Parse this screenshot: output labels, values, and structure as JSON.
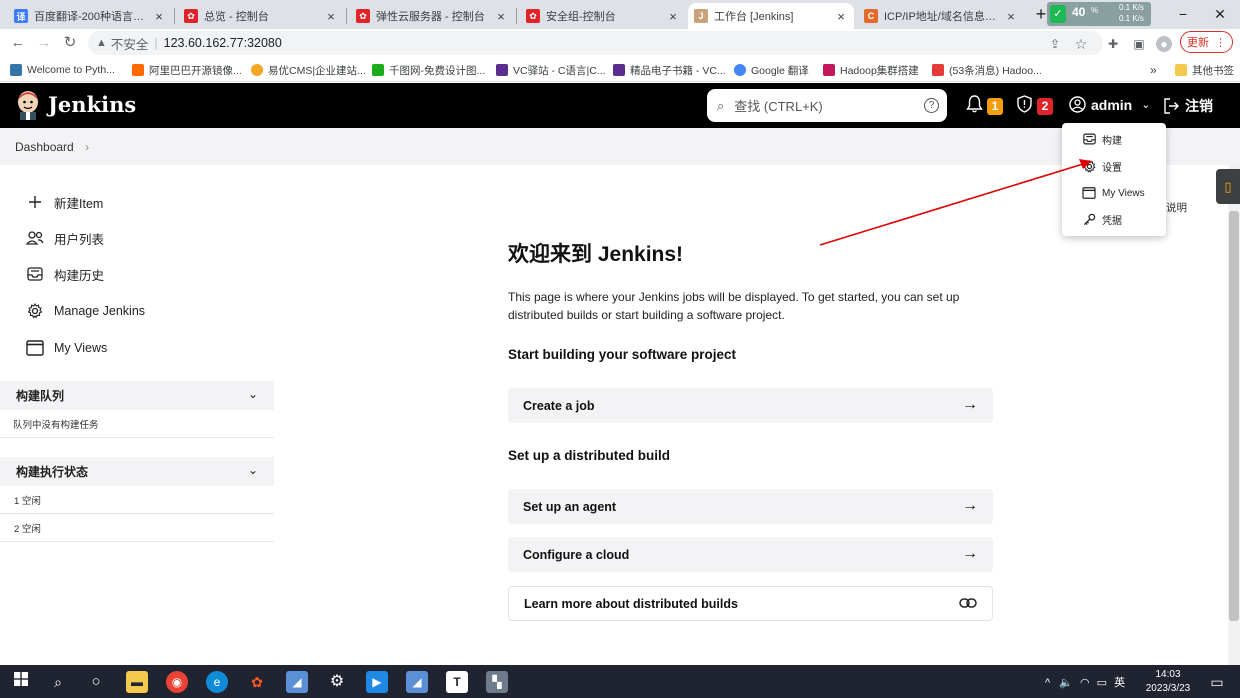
{
  "browser": {
    "tabs": [
      {
        "title": "百度翻译-200种语言互译、",
        "favicon_color": "#3b7cff",
        "favicon_text": "译"
      },
      {
        "title": "总览 - 控制台",
        "favicon_color": "#e0242a",
        "favicon_text": "✿"
      },
      {
        "title": "弹性云服务器 - 控制台",
        "favicon_color": "#e0242a",
        "favicon_text": "✿"
      },
      {
        "title": "安全组-控制台",
        "favicon_color": "#e0242a",
        "favicon_text": "✿"
      },
      {
        "title": "工作台 [Jenkins]",
        "favicon_color": "#c9a27a",
        "favicon_text": "J"
      },
      {
        "title": "ICP/IP地址/域名信息备案管",
        "favicon_color": "#e36b2c",
        "favicon_text": "C"
      }
    ],
    "new_tab_label": "+",
    "net_speed": {
      "percent": "40",
      "up": "0.1 K/s",
      "down": "0.1 K/s"
    },
    "address": {
      "security_label": "不安全",
      "url": "123.60.162.77:32080"
    },
    "update_label": "更新",
    "bookmarks": [
      {
        "label": "Welcome to Pyth...",
        "color": "#3776ab"
      },
      {
        "label": "阿里巴巴开源镜像...",
        "color": "#ff6a00"
      },
      {
        "label": "易优CMS|企业建站...",
        "color": "#f5a623"
      },
      {
        "label": "千图网-免费设计图...",
        "color": "#1aad19"
      },
      {
        "label": "VC驿站 - C语言|C...",
        "color": "#5c2d91"
      },
      {
        "label": "精品电子书籍 - VC...",
        "color": "#5c2d91"
      },
      {
        "label": "Google 翻译",
        "color": "#4285f4"
      },
      {
        "label": "Hadoop集群搭建",
        "color": "#c2185b"
      },
      {
        "label": "(53条消息) Hadoo...",
        "color": "#e53935"
      }
    ],
    "bookmarks_more": "»",
    "other_bookmarks": "其他书签"
  },
  "jenkins": {
    "title": "Jenkins",
    "search_placeholder": "查找 (CTRL+K)",
    "search_help": "?",
    "notifications_count": "1",
    "security_count": "2",
    "user": "admin",
    "logout_label": "注销",
    "breadcrumb": "Dashboard",
    "breadcrumb_sep": "›",
    "side_nav": [
      {
        "label": "新建Item",
        "icon": "plus-icon"
      },
      {
        "label": "用户列表",
        "icon": "people-icon"
      },
      {
        "label": "构建历史",
        "icon": "inbox-icon"
      },
      {
        "label": "Manage Jenkins",
        "icon": "gear-icon"
      },
      {
        "label": "My Views",
        "icon": "window-icon"
      }
    ],
    "build_queue": {
      "title": "构建队列",
      "empty_text": "队列中没有构建任务"
    },
    "executors": {
      "title": "构建执行状态",
      "rows": [
        "1  空闲",
        "2  空闲"
      ]
    },
    "welcome_title": "欢迎来到 Jenkins!",
    "welcome_desc": "This page is where your Jenkins jobs will be displayed. To get started, you can set up distributed builds or start building a software project.",
    "start_heading": "Start building your software project",
    "create_job": "Create a job",
    "distributed_heading": "Set up a distributed build",
    "setup_agent": "Set up an agent",
    "configure_cloud": "Configure a cloud",
    "learn_more": "Learn more about distributed builds",
    "description_link": "说明",
    "user_menu": [
      {
        "label": "构建",
        "icon": "inbox-icon"
      },
      {
        "label": "设置",
        "icon": "gear-icon"
      },
      {
        "label": "My Views",
        "icon": "window-icon"
      },
      {
        "label": "凭据",
        "icon": "key-icon"
      }
    ]
  },
  "taskbar": {
    "time": "14:03",
    "date": "2023/3/23",
    "ime": "英",
    "tray_arrow": "^"
  },
  "colors": {
    "jenkins_header": "#000000",
    "badge_notification": "#f59e0b",
    "badge_security": "#e0242a",
    "annotation_arrow": "#e00000"
  }
}
